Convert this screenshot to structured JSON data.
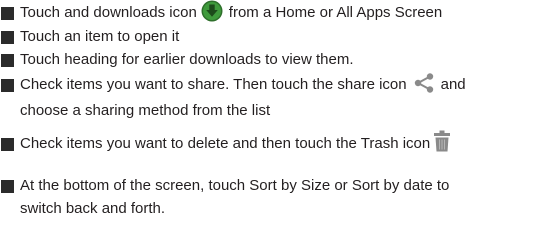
{
  "items": [
    {
      "before_icon": "Touch and downloads icon",
      "icon": "download-icon",
      "after_icon": "from a Home or All Apps Screen"
    },
    {
      "text": "Touch an item to open it"
    },
    {
      "text": "Touch heading for earlier downloads to view them."
    },
    {
      "before_icon": "Check items you want to share. Then touch the share icon",
      "icon": "share-icon",
      "after_icon": "and",
      "continuation": "choose a sharing method from the list"
    },
    {
      "before_icon": "Check items you want to delete and then touch the Trash icon",
      "icon": "trash-icon"
    },
    {
      "text": "At the bottom of the screen, touch Sort by Size or Sort by date to",
      "continuation": "switch back and forth."
    }
  ],
  "colors": {
    "text": "#231f20",
    "bullet": "#2b2b2b",
    "download_icon_green": "#3f9a3c",
    "download_icon_dark": "#2e6f2b",
    "icon_gray": "#8a8a8a"
  }
}
